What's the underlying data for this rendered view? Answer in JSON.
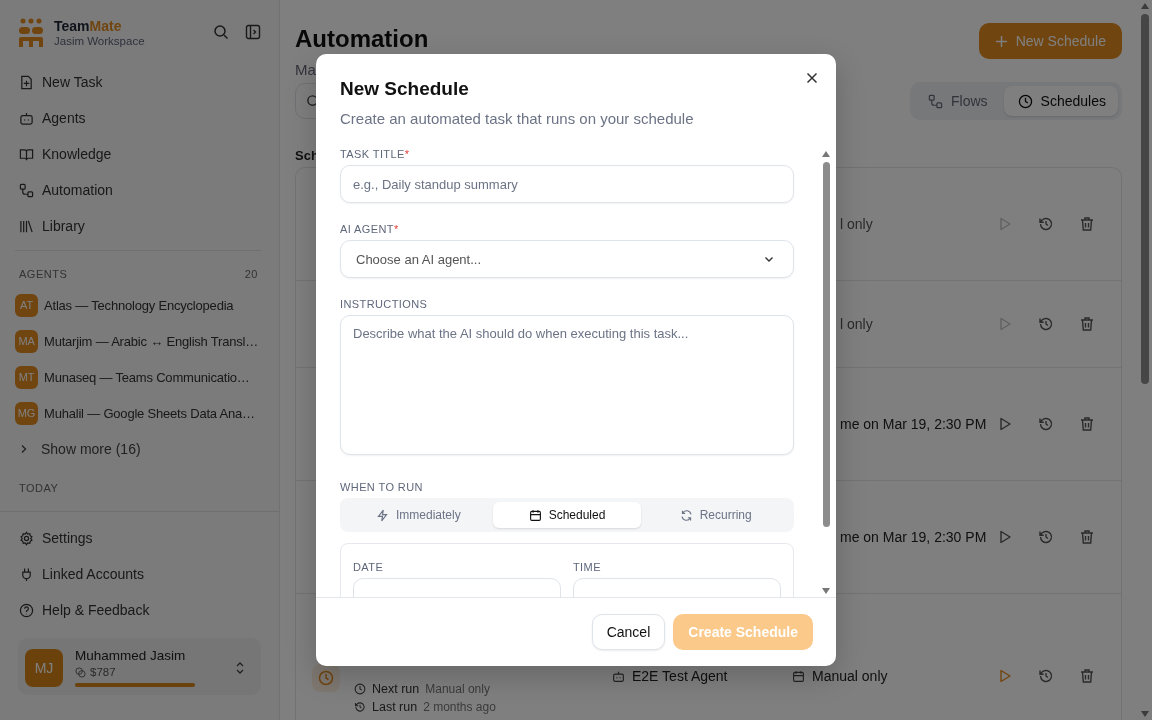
{
  "sidebar": {
    "brand_prefix": "Team",
    "brand_suffix": "Mate",
    "workspace": "Jasim Workspace",
    "nav": [
      {
        "label": "New Task"
      },
      {
        "label": "Agents"
      },
      {
        "label": "Knowledge"
      },
      {
        "label": "Automation"
      },
      {
        "label": "Library"
      }
    ],
    "agents_heading": "AGENTS",
    "agents_count": "20",
    "agents": [
      {
        "initials": "AT",
        "name": "Atlas — Technology Encyclopedia"
      },
      {
        "initials": "MA",
        "name": "Mutarjim — Arabic ↔ English Transl…"
      },
      {
        "initials": "MT",
        "name": "Munaseq — Teams Communicatio…"
      },
      {
        "initials": "MG",
        "name": "Muhalil — Google Sheets Data Ana…"
      }
    ],
    "show_more": "Show more (16)",
    "today": "TODAY",
    "footer_nav": [
      {
        "label": "Settings"
      },
      {
        "label": "Linked Accounts"
      },
      {
        "label": "Help & Feedback"
      }
    ],
    "user": {
      "initials": "MJ",
      "name": "Muhammed Jasim",
      "credits": "$787",
      "level": 1
    }
  },
  "main": {
    "title": "Automation",
    "subtitle": "Ma",
    "new_button": "New Schedule",
    "tabs": [
      {
        "label": "Flows",
        "selected": false
      },
      {
        "label": "Schedules",
        "selected": true
      }
    ],
    "section": "Sch",
    "rows": [
      {
        "kind": "covered",
        "schedule": "l only",
        "run_disabled": true,
        "run_highlighted": false
      },
      {
        "kind": "covered",
        "schedule": "l only",
        "run_disabled": true,
        "run_highlighted": false
      },
      {
        "kind": "covered",
        "schedule": "me on Mar 19, 2:30 PM",
        "run_disabled": false,
        "run_highlighted": false
      },
      {
        "kind": "covered",
        "schedule": "me on Mar 19, 2:30 PM",
        "run_disabled": false,
        "run_highlighted": false
      },
      {
        "kind": "full",
        "agent": "E2E Test Agent",
        "schedule": "Manual only",
        "next_label": "Next run",
        "next_value": "Manual only",
        "last_label": "Last run",
        "last_value": "2 months ago",
        "run_disabled": false,
        "run_highlighted": true
      }
    ]
  },
  "modal": {
    "title": "New Schedule",
    "subtitle": "Create an automated task that runs on your schedule",
    "required_mark": "*",
    "fields": [
      {
        "kind": "text",
        "label": "TASK TITLE",
        "required": true,
        "placeholder": "e.g., Daily standup summary"
      },
      {
        "kind": "select",
        "label": "AI AGENT",
        "required": true,
        "placeholder": "Choose an AI agent..."
      },
      {
        "kind": "textarea",
        "label": "INSTRUCTIONS",
        "required": false,
        "placeholder": "Describe what the AI should do when executing this task..."
      }
    ],
    "when_label": "WHEN TO RUN",
    "when_options": [
      {
        "label": "Immediately",
        "selected": false
      },
      {
        "label": "Scheduled",
        "selected": true
      },
      {
        "label": "Recurring",
        "selected": false
      }
    ],
    "date_label": "DATE",
    "time_label": "TIME",
    "cancel": "Cancel",
    "create": {
      "label": "Create Schedule",
      "disabled": true
    }
  }
}
